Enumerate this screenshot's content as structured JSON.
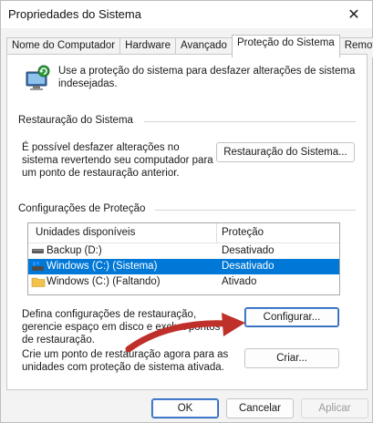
{
  "window": {
    "title": "Propriedades do Sistema",
    "close_glyph": "✕"
  },
  "tabs": [
    {
      "label": "Nome do Computador",
      "active": false
    },
    {
      "label": "Hardware",
      "active": false
    },
    {
      "label": "Avançado",
      "active": false
    },
    {
      "label": "Proteção do Sistema",
      "active": true
    },
    {
      "label": "Remoto",
      "active": false
    }
  ],
  "intro": {
    "icon": "system-protection-icon",
    "text": "Use a proteção do sistema para desfazer alterações de sistema indesejadas."
  },
  "restore": {
    "section_title": "Restauração do Sistema",
    "description": "É possível desfazer alterações no sistema revertendo seu computador para um ponto de restauração anterior.",
    "button_label": "Restauração do Sistema..."
  },
  "protection": {
    "section_title": "Configurações de Proteção",
    "columns": [
      "Unidades disponíveis",
      "Proteção"
    ],
    "rows": [
      {
        "drive": "Backup (D:)",
        "status": "Desativado",
        "icon": "drive-icon",
        "selected": false
      },
      {
        "drive": "Windows (C:) (Sistema)",
        "status": "Desativado",
        "icon": "system-drive-icon",
        "selected": true
      },
      {
        "drive": "Windows (C:) (Faltando)",
        "status": "Ativado",
        "icon": "folder-drive-icon",
        "selected": false
      }
    ],
    "configure_desc": "Defina configurações de restauração, gerencie espaço em disco e exclua pontos de restauração.",
    "configure_button": "Configurar...",
    "create_desc": "Crie um ponto de restauração agora para as unidades com proteção de sistema ativada.",
    "create_button": "Criar..."
  },
  "footer": {
    "ok": "OK",
    "cancel": "Cancelar",
    "apply": "Aplicar"
  },
  "colors": {
    "selection": "#0078d7",
    "arrow": "#c0302b",
    "accent_border": "#2f64b5"
  }
}
